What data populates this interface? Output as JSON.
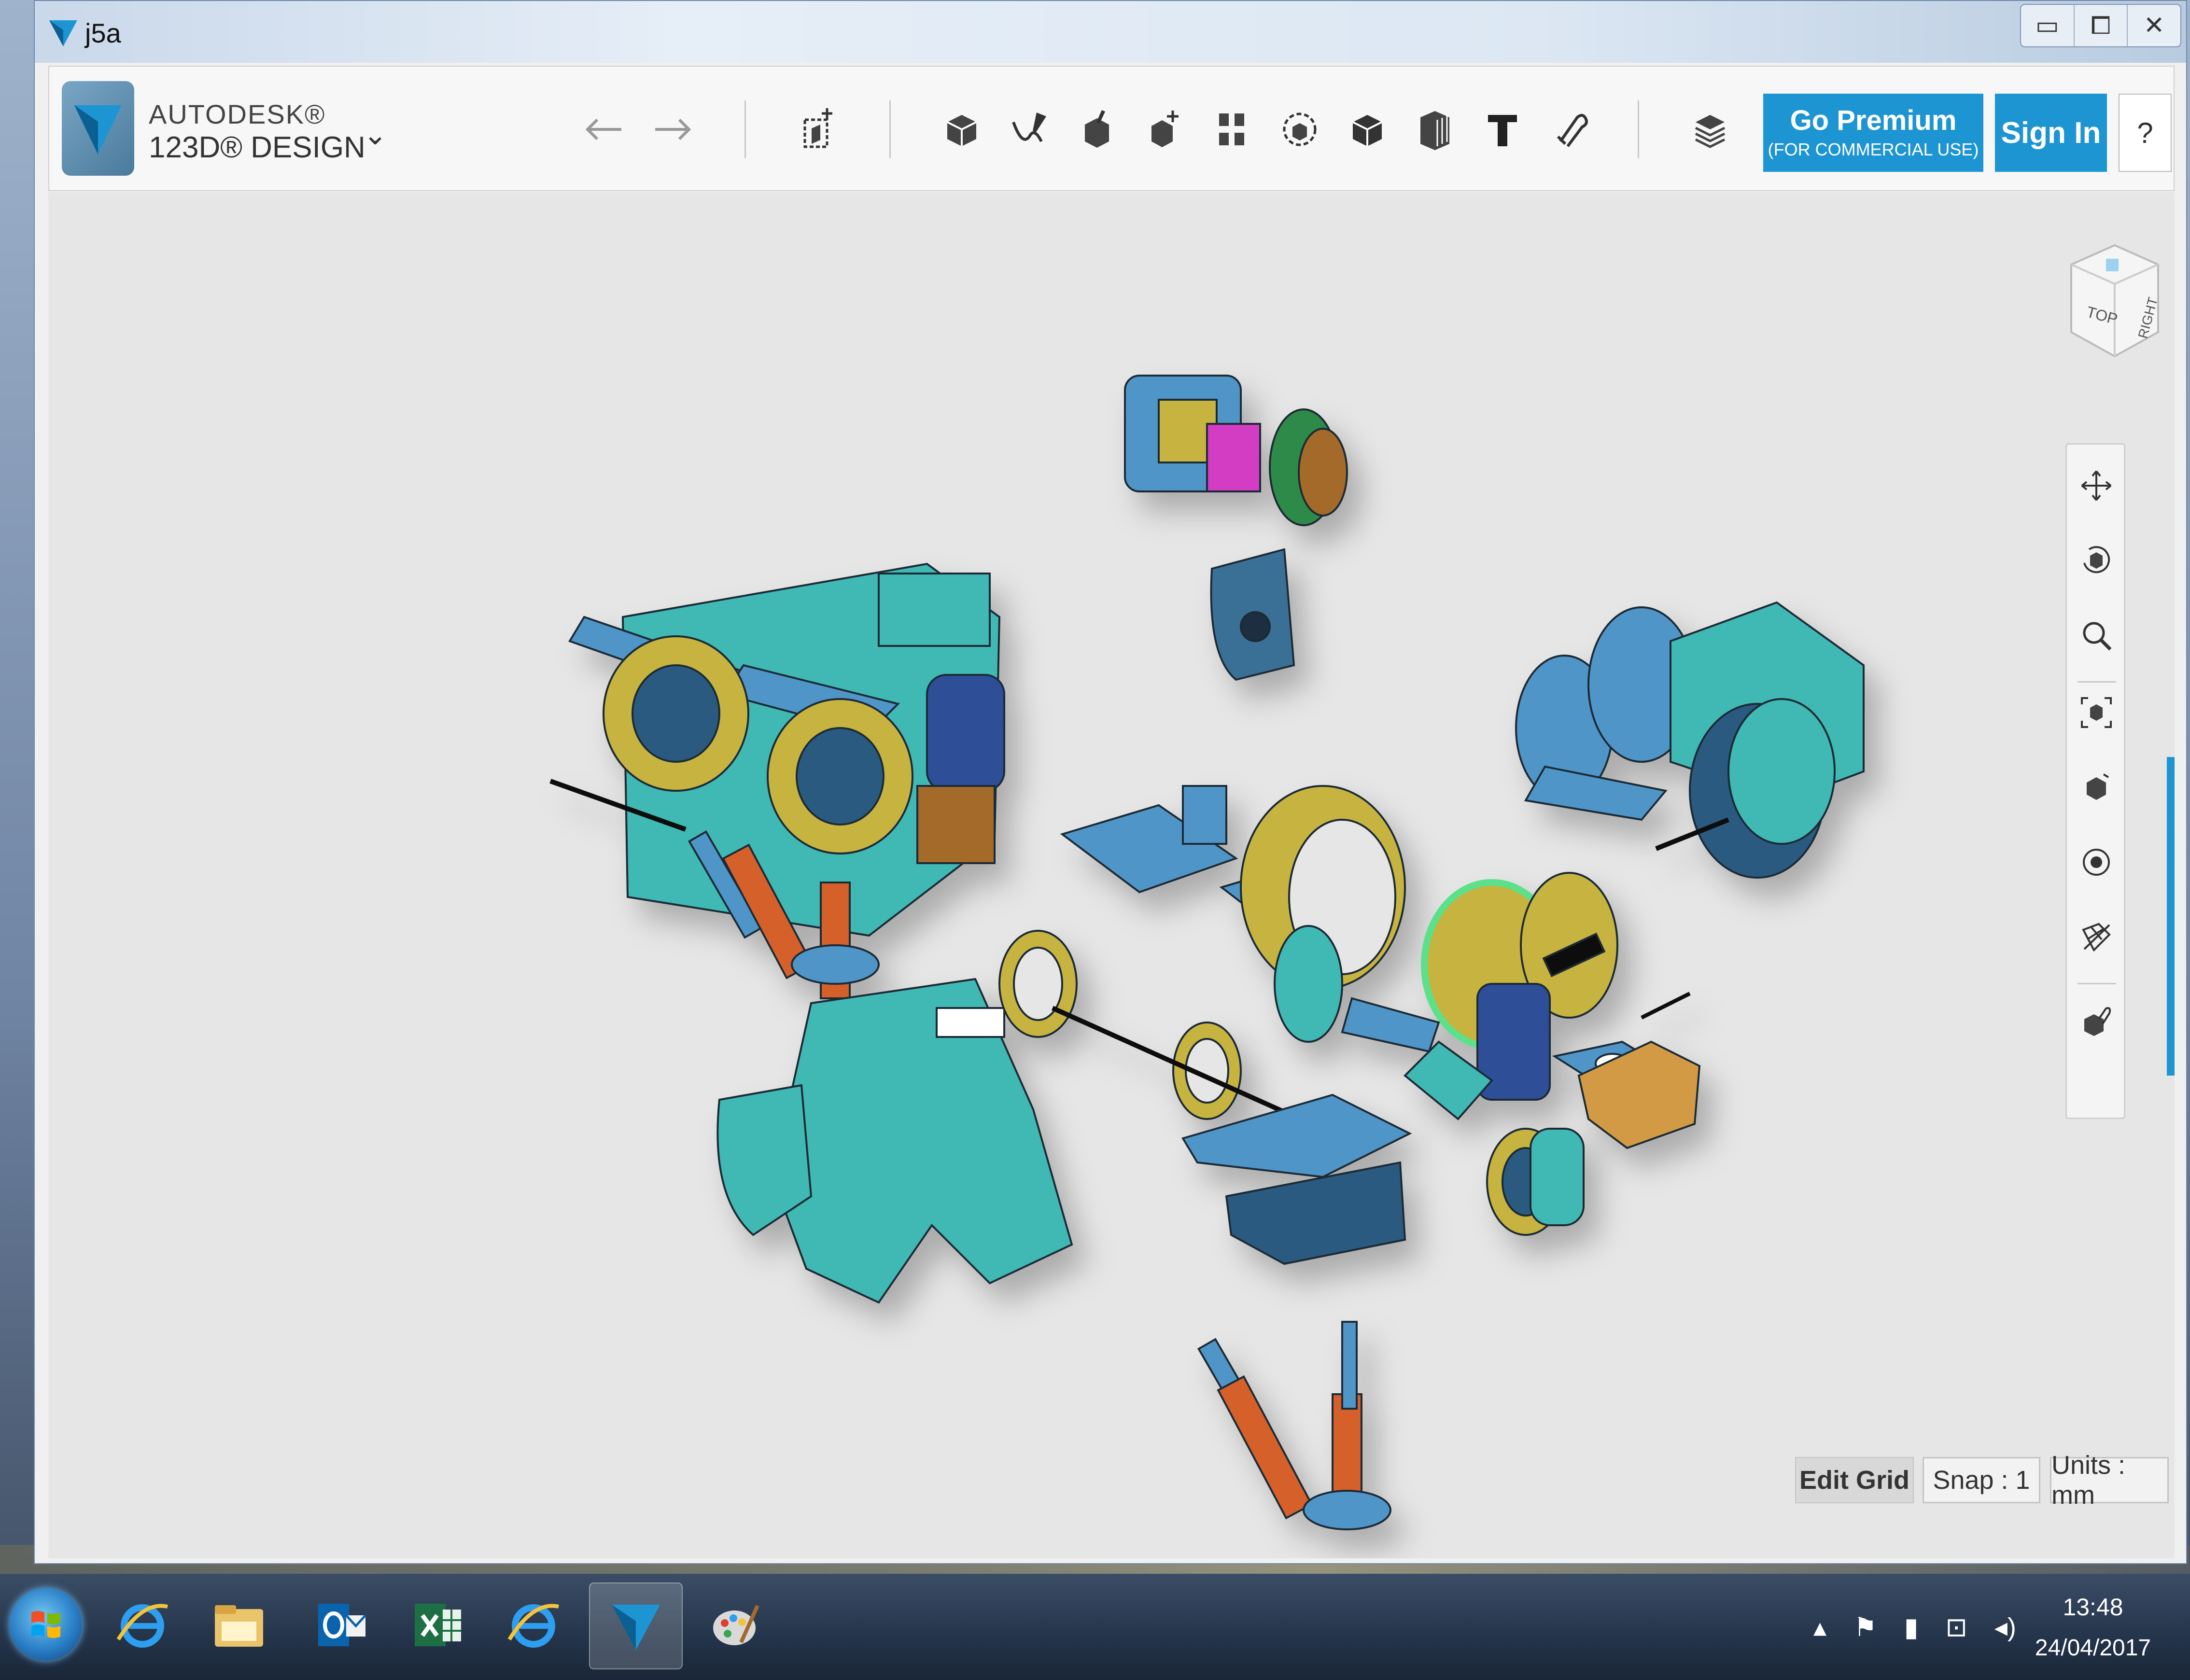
{
  "window": {
    "title": "j5a",
    "controls": [
      "▭",
      "⧠",
      "✕"
    ]
  },
  "brand": {
    "line1": "AUTODESK®",
    "line2": "123D® DESIGN"
  },
  "toolbar": {
    "undo_icon": "undo-icon",
    "redo_icon": "redo-icon",
    "tools": [
      "transform",
      "primitives",
      "sketch",
      "construct",
      "modify",
      "pattern",
      "grouping",
      "combine",
      "measure",
      "text",
      "snap",
      "material"
    ]
  },
  "buttons": {
    "premium_line1": "Go Premium",
    "premium_line2": "(FOR COMMERCIAL USE)",
    "sign_in": "Sign In",
    "help": "?"
  },
  "viewcube": {
    "top": "TOP",
    "right": "RIGHT"
  },
  "status": {
    "edit_grid": "Edit Grid",
    "snap": "Snap : 1",
    "units": "Units : mm"
  },
  "taskbar": {
    "apps": [
      "internet-explorer",
      "file-explorer",
      "outlook",
      "excel",
      "internet-explorer",
      "123d-design",
      "paint"
    ],
    "time": "13:48",
    "date": "24/04/2017"
  },
  "colors": {
    "accent": "#1e95d3",
    "part_blue": "#4f95c8",
    "part_teal": "#3fb8b4",
    "part_gold": "#c7b341",
    "part_orange": "#d5602a"
  }
}
